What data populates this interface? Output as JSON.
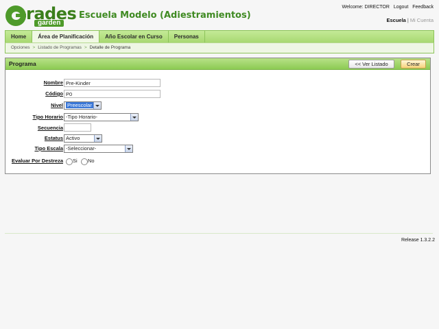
{
  "header": {
    "logo_word": "rades",
    "logo_sub": "garden",
    "site_title": "Escuela Modelo (Adiestramientos)",
    "welcome": "Welcome: DIRECTOR",
    "logout": "Logout",
    "feedback": "Feedback",
    "school_tab": "Escuela",
    "account_tab": "Mi Cuenta"
  },
  "nav": {
    "tabs": [
      "Home",
      "Área de Planificación",
      "Año Escolar en Curso",
      "Personas"
    ],
    "selected": "Área de Planificación"
  },
  "breadcrumbs": [
    "Opciones",
    "Listado de Programas",
    "Detalle de Programa"
  ],
  "panel": {
    "title": "Programa",
    "list_button": "<< Ver Listado",
    "create_button": "Crear"
  },
  "form": {
    "nombre_label": "Nombre",
    "nombre_value": "Pre-Kinder",
    "codigo_label": "Código",
    "codigo_value": "P0",
    "nivel_label": "Nivel",
    "nivel_value": "Preescolar",
    "tipo_horario_label": "Tipo Horario",
    "tipo_horario_value": "-Tipo Horario-",
    "secuencia_label": "Secuencia",
    "secuencia_value": "",
    "estatus_label": "Estatus",
    "estatus_value": "Activo",
    "tipo_escala_label": "Tipo Escala",
    "tipo_escala_value": "-Seleccionar-",
    "evaluar_label": "Evaluar Por Destreza",
    "si": "Si",
    "no": "No"
  },
  "footer": {
    "release": "Release 1.3.2.2"
  }
}
